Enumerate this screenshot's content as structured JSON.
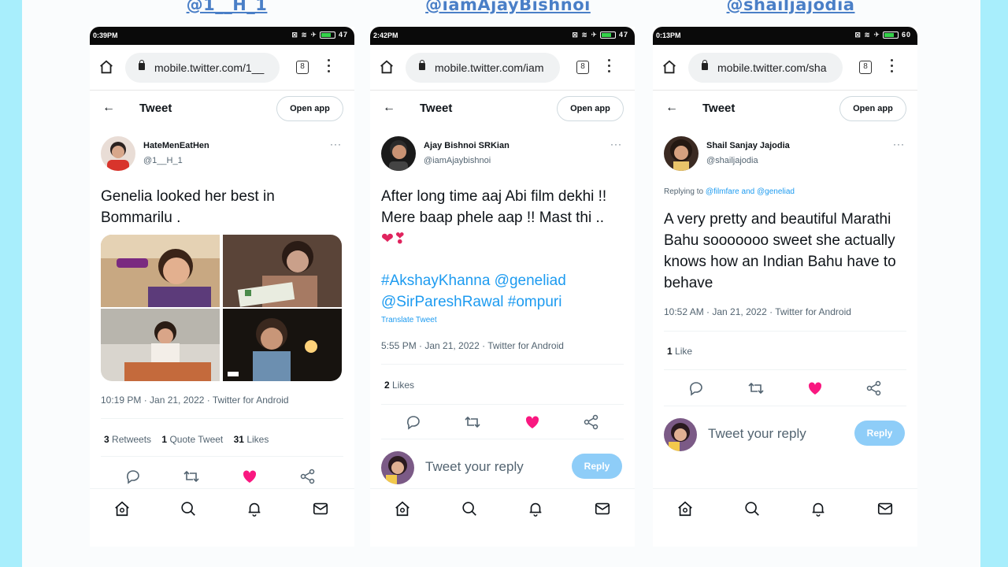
{
  "colors": {
    "background": "#a8eefc",
    "handle": "#4a7fc7",
    "link": "#1d9bf0",
    "like": "#f91880",
    "reply_button": "#8ecdf8"
  },
  "phones": [
    {
      "handle_caption": "@1__H_1",
      "status_time": "0:39PM",
      "status_battery": "47",
      "url": "mobile.twitter.com/1__",
      "tab_count": "8",
      "nav_title": "Tweet",
      "open_app": "Open app",
      "display_name": "HateMenEatHen",
      "username": "@1__H_1",
      "text": "Genelia looked her best in Bommarilu .",
      "timestamp": "10:19 PM · Jan 21, 2022 · Twitter for Android",
      "stats": {
        "retweets": "3",
        "retweets_label": "Retweets",
        "quotes": "1",
        "quotes_label": "Quote Tweet",
        "likes": "31",
        "likes_label": "Likes"
      },
      "media_images": [
        "photo-1",
        "photo-2",
        "photo-3",
        "photo-4"
      ]
    },
    {
      "handle_caption": "@iamAjayBishnoi",
      "status_time": "2:42PM",
      "status_battery": "47",
      "url": "mobile.twitter.com/iam",
      "tab_count": "8",
      "nav_title": "Tweet",
      "open_app": "Open app",
      "display_name": "Ajay Bishnoi SRKian",
      "username": "@iamAjaybishnoi",
      "text": "After long time aaj Abi film dekhi !! Mere baap phele aap !! Mast thi ..",
      "text_emoji": "❤❣",
      "hashtags": "#AkshayKhanna @geneliad @SirPareshRawal #ompuri",
      "translate": "Translate Tweet",
      "timestamp": "5:55 PM · Jan 21, 2022 · Twitter for Android",
      "stats": {
        "likes": "2",
        "likes_label": "Likes"
      },
      "reply_placeholder": "Tweet your reply",
      "reply_button": "Reply"
    },
    {
      "handle_caption": "@shailjajodia",
      "status_time": "0:13PM",
      "status_battery": "60",
      "url": "mobile.twitter.com/sha",
      "tab_count": "8",
      "nav_title": "Tweet",
      "open_app": "Open app",
      "display_name": "Shail Sanjay Jajodia",
      "username": "@shailjajodia",
      "replying_prefix": "Replying to",
      "replying_mentions": "@filmfare and @geneliad",
      "text": "A very pretty and beautiful Marathi Bahu sooooooo sweet she actually knows how an Indian Bahu have to behave",
      "timestamp": "10:52 AM · Jan 21, 2022 · Twitter for Android",
      "stats": {
        "likes": "1",
        "likes_label": "Like"
      },
      "reply_placeholder": "Tweet your reply",
      "reply_button": "Reply"
    }
  ],
  "icons": {
    "action_bar": [
      "reply-icon",
      "retweet-icon",
      "like-icon",
      "share-icon"
    ],
    "bottom_nav": [
      "home-icon",
      "search-icon",
      "notifications-icon",
      "messages-icon"
    ]
  }
}
